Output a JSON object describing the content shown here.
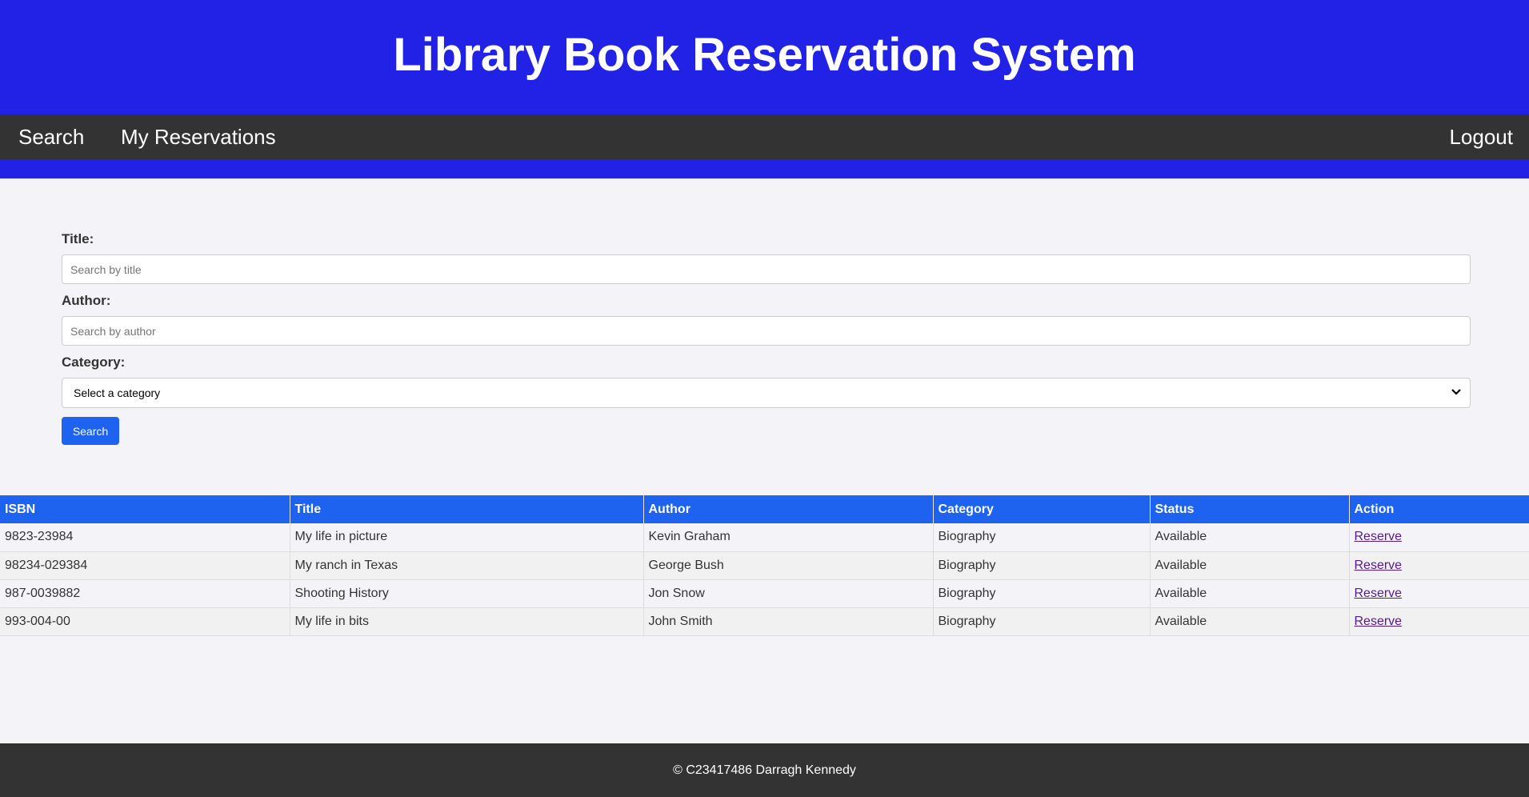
{
  "header": {
    "title": "Library Book Reservation System"
  },
  "nav": {
    "search": "Search",
    "reservations": "My Reservations",
    "logout": "Logout"
  },
  "form": {
    "title_label": "Title:",
    "title_placeholder": "Search by title",
    "author_label": "Author:",
    "author_placeholder": "Search by author",
    "category_label": "Category:",
    "category_selected": "Select a category",
    "search_button": "Search"
  },
  "table": {
    "headers": [
      "ISBN",
      "Title",
      "Author",
      "Category",
      "Status",
      "Action"
    ],
    "rows": [
      {
        "isbn": "9823-23984",
        "title": "My life in picture",
        "author": "Kevin Graham",
        "category": "Biography",
        "status": "Available",
        "action": "Reserve"
      },
      {
        "isbn": "98234-029384",
        "title": "My ranch in Texas",
        "author": "George Bush",
        "category": "Biography",
        "status": "Available",
        "action": "Reserve"
      },
      {
        "isbn": "987-0039882",
        "title": "Shooting History",
        "author": "Jon Snow",
        "category": "Biography",
        "status": "Available",
        "action": "Reserve"
      },
      {
        "isbn": "993-004-00",
        "title": "My life in bits",
        "author": "John Smith",
        "category": "Biography",
        "status": "Available",
        "action": "Reserve"
      }
    ]
  },
  "footer": {
    "text": "© C23417486 Darragh Kennedy"
  },
  "colors": {
    "header_bg": "#2222e6",
    "nav_bg": "#333333",
    "accent": "#1e62f0",
    "link": "#551a8b"
  }
}
